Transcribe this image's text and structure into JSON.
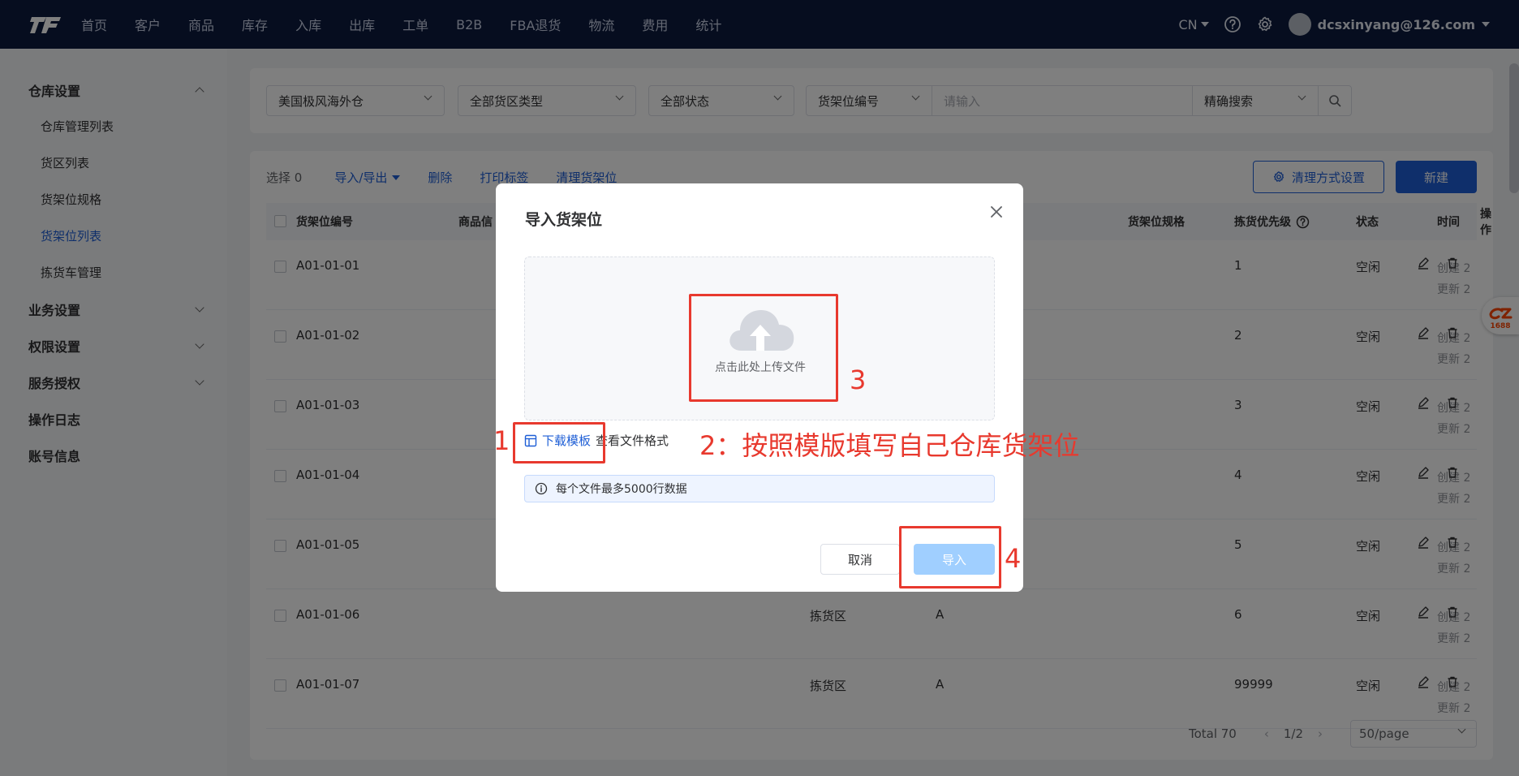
{
  "nav": {
    "items": [
      "首页",
      "客户",
      "商品",
      "库存",
      "入库",
      "出库",
      "工单",
      "B2B",
      "FBA退货",
      "物流",
      "费用",
      "统计"
    ],
    "lang": "CN",
    "user": "dcsxinyang@126.com"
  },
  "sidebar": {
    "warehouse_settings": "仓库设置",
    "sub": [
      "仓库管理列表",
      "货区列表",
      "货架位规格",
      "货架位列表",
      "拣货车管理"
    ],
    "business_settings": "业务设置",
    "permission_settings": "权限设置",
    "service_auth": "服务授权",
    "operation_log": "操作日志",
    "account_info": "账号信息"
  },
  "filters": {
    "warehouse": "美国极风海外仓",
    "zone_type": "全部货区类型",
    "status": "全部状态",
    "field": "货架位编号",
    "input_placeholder": "请输入",
    "search_mode": "精确搜索"
  },
  "toolbar": {
    "selected": "选择 0",
    "import_export": "导入/导出",
    "delete": "删除",
    "print": "打印标签",
    "clear": "清理货架位",
    "clear_settings": "清理方式设置",
    "new": "新建"
  },
  "table": {
    "headers": {
      "code": "货架位编号",
      "product": "商品信",
      "spec": "货架位规格",
      "priority": "拣货优先级",
      "status": "状态",
      "time": "时间",
      "ops": "操作"
    },
    "rows": [
      {
        "code": "A01-01-01",
        "zone": "",
        "area": "",
        "priority": "1",
        "status": "空闲"
      },
      {
        "code": "A01-01-02",
        "zone": "",
        "area": "",
        "priority": "2",
        "status": "空闲"
      },
      {
        "code": "A01-01-03",
        "zone": "",
        "area": "",
        "priority": "3",
        "status": "空闲"
      },
      {
        "code": "A01-01-04",
        "zone": "",
        "area": "",
        "priority": "4",
        "status": "空闲"
      },
      {
        "code": "A01-01-05",
        "zone": "",
        "area": "",
        "priority": "5",
        "status": "空闲"
      },
      {
        "code": "A01-01-06",
        "zone": "拣货区",
        "area": "A",
        "priority": "6",
        "status": "空闲"
      },
      {
        "code": "A01-01-07",
        "zone": "拣货区",
        "area": "A",
        "priority": "99999",
        "status": "空闲"
      }
    ],
    "time_created": "创建 2",
    "time_updated": "更新 2"
  },
  "pagination": {
    "total": "Total 70",
    "page": "1/2",
    "size": "50/page"
  },
  "modal": {
    "title": "导入货架位",
    "upload_text": "点击此处上传文件",
    "download_template": "下载模板",
    "view_format": "查看文件格式",
    "limit_note": "每个文件最多5000行数据",
    "cancel": "取消",
    "import": "导入"
  },
  "annotations": {
    "n1": "1",
    "n2": "2：按照模版填写自己仓库货架位",
    "n3": "3",
    "n4": "4"
  },
  "badge": {
    "label": "1688"
  },
  "colors": {
    "nav_bg": "#0d1b3e",
    "primary": "#1f5fd6",
    "annotation_red": "#e8392e",
    "import_disabled": "#a0cfff"
  }
}
